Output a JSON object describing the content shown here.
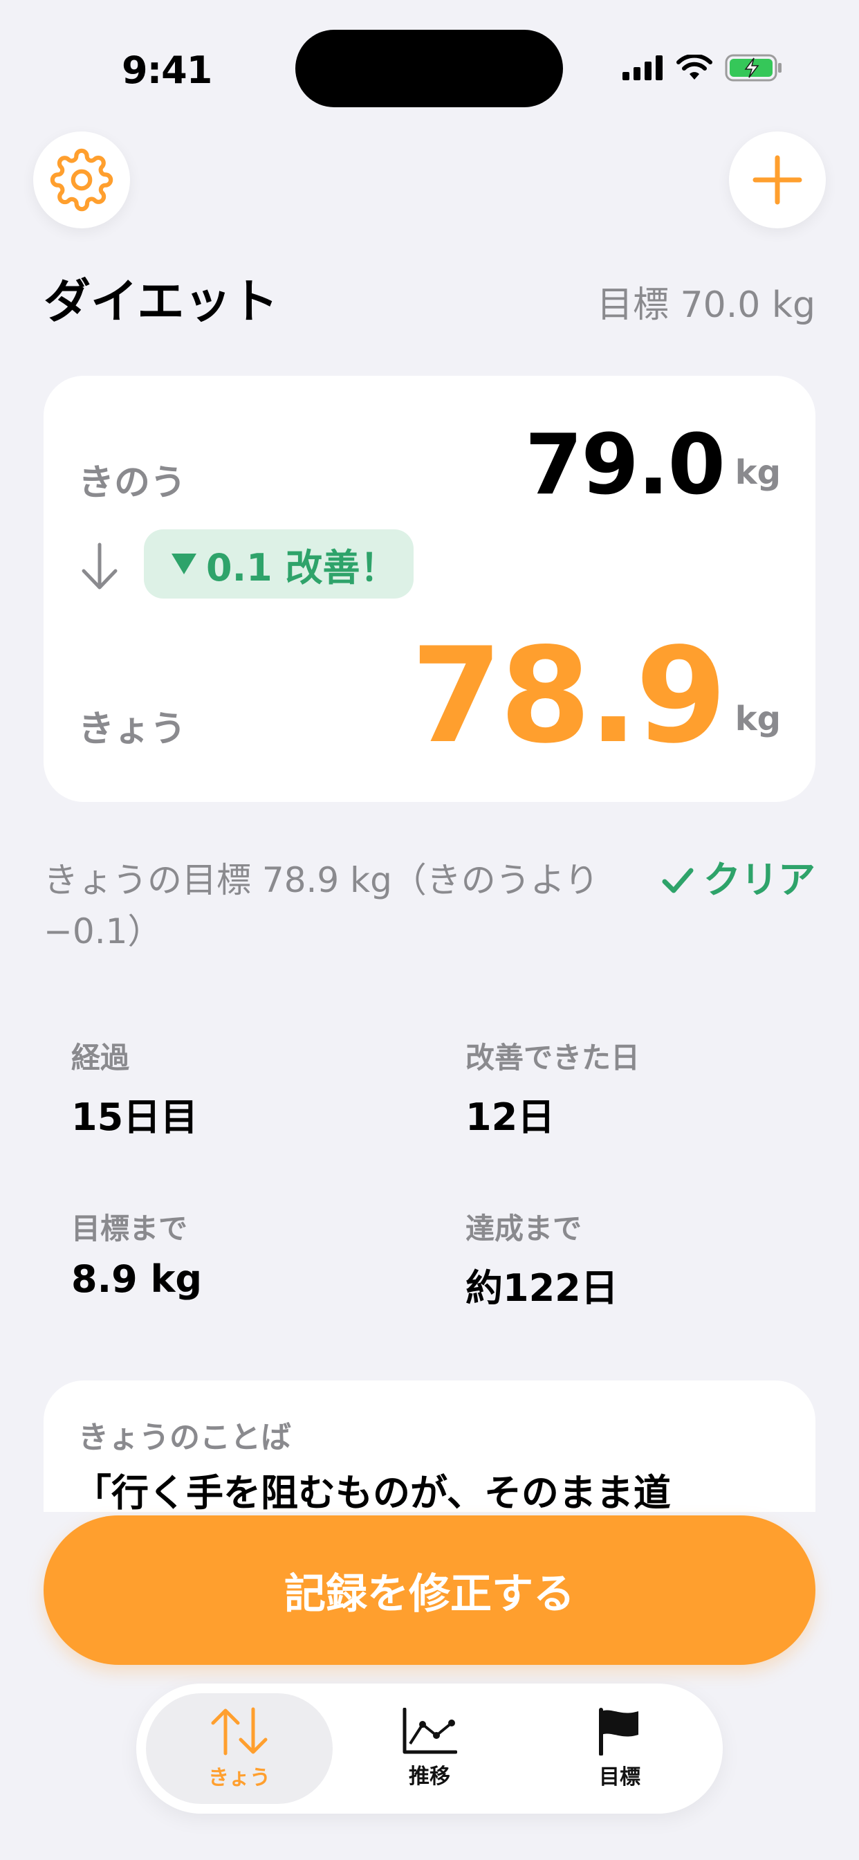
{
  "status_bar": {
    "time": "9:41"
  },
  "header": {
    "title": "ダイエット",
    "goal": "目標 70.0 kg"
  },
  "card": {
    "yesterday_label": "きのう",
    "yesterday_value": "79.0",
    "yesterday_unit": "kg",
    "change_badge": "0.1 改善！",
    "today_label": "きょう",
    "today_value": "78.9",
    "today_unit": "kg"
  },
  "today_goal": {
    "text": "きょうの目標 78.9 kg（きのうより −0.1）",
    "status": "クリア"
  },
  "stats": [
    {
      "label": "経過",
      "value": "15日目"
    },
    {
      "label": "改善できた日",
      "value": "12日"
    },
    {
      "label": "目標まで",
      "value": "8.9 kg"
    },
    {
      "label": "達成まで",
      "value": "約122日"
    }
  ],
  "quote": {
    "label": "きょうのことば",
    "text": "「行く手を阻むものが、そのまま道"
  },
  "cta": {
    "label": "記録を修正する"
  },
  "tabs": [
    {
      "label": "きょう"
    },
    {
      "label": "推移"
    },
    {
      "label": "目標"
    }
  ],
  "colors": {
    "accent": "#FF9F2E",
    "success": "#2EA36A",
    "background": "#F2F2F7"
  }
}
